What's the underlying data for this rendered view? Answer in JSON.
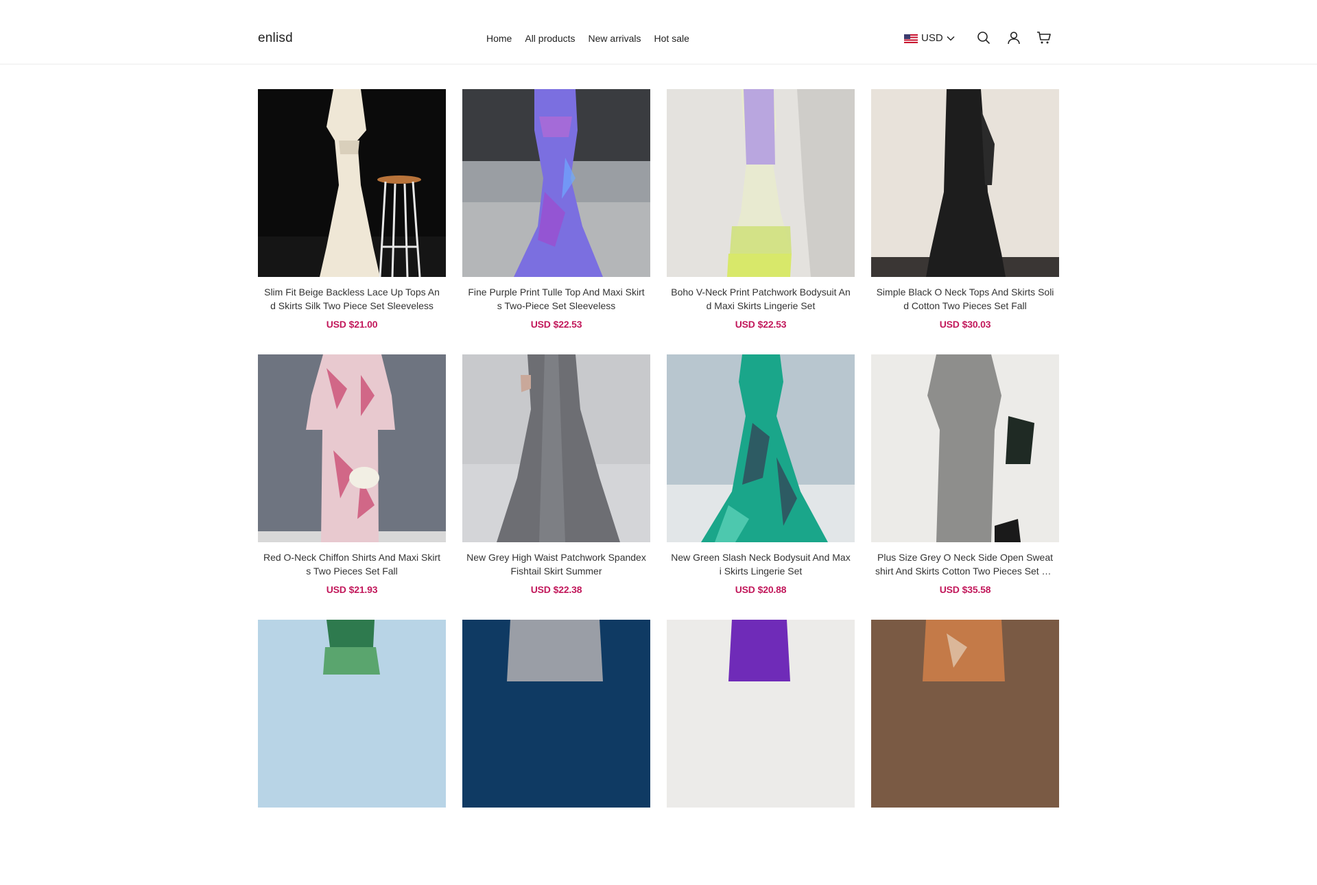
{
  "header": {
    "logo": "enlisd",
    "nav": [
      "Home",
      "All products",
      "New arrivals",
      "Hot sale"
    ],
    "currency": "USD",
    "icons": [
      "search-icon",
      "account-icon",
      "cart-icon"
    ]
  },
  "products": [
    {
      "title": "Slim Fit Beige Backless Lace Up Tops And Skirts Silk Two Piece Set Sleeveless",
      "currency": "USD",
      "price": "$21.00"
    },
    {
      "title": "Fine Purple Print Tulle Top And Maxi Skirts Two-Piece Set Sleeveless",
      "currency": "USD",
      "price": "$22.53"
    },
    {
      "title": "Boho V-Neck Print Patchwork Bodysuit And Maxi Skirts Lingerie Set",
      "currency": "USD",
      "price": "$22.53"
    },
    {
      "title": "Simple Black O Neck Tops And Skirts Solid Cotton Two Pieces Set Fall",
      "currency": "USD",
      "price": "$30.03"
    },
    {
      "title": "Red O-Neck Chiffon Shirts And Maxi Skirts Two Pieces Set Fall",
      "currency": "USD",
      "price": "$21.93"
    },
    {
      "title": "New Grey High Waist Patchwork Spandex Fishtail Skirt Summer",
      "currency": "USD",
      "price": "$22.38"
    },
    {
      "title": "New Green Slash Neck Bodysuit And Maxi Skirts Lingerie Set",
      "currency": "USD",
      "price": "$20.88"
    },
    {
      "title": "Plus Size Grey O Neck Side Open Sweatshirt And Skirts Cotton Two Pieces Set Fall",
      "currency": "USD",
      "price": "$35.58"
    }
  ],
  "colors": {
    "price": "#c2185b",
    "border": "#ececec"
  }
}
